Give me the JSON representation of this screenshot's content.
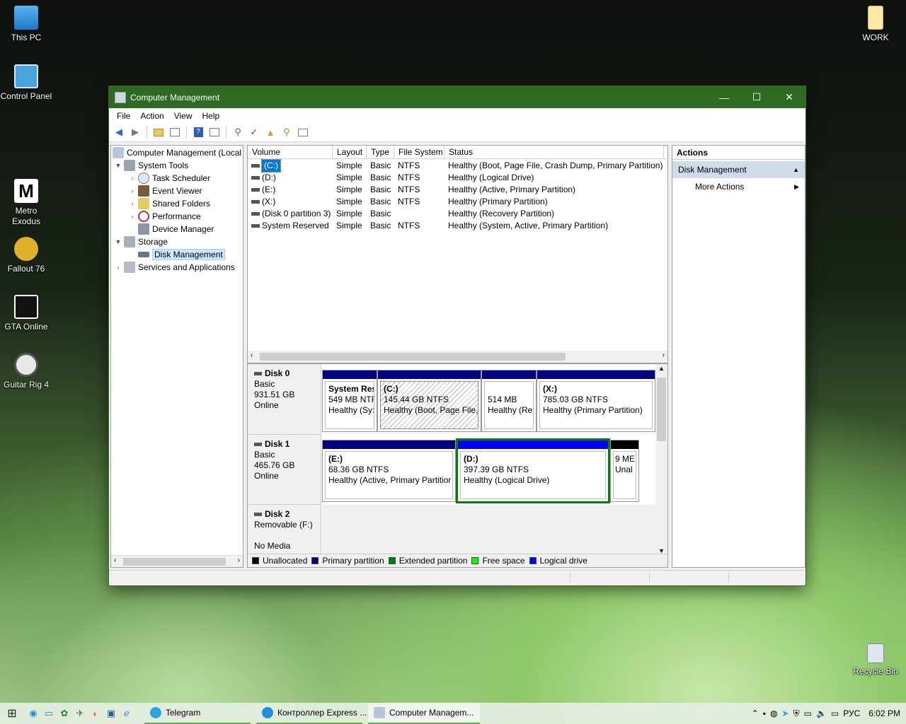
{
  "desktop": {
    "icons_left": [
      "This PC",
      "Control Panel",
      "Metro Exodus",
      "Fallout 76",
      "GTA Online",
      "Guitar Rig 4"
    ],
    "work": "WORK",
    "recycle": "Recycle Bin"
  },
  "window": {
    "title": "Computer Management",
    "controls": {
      "minimize": "—",
      "maximize": "☐",
      "close": "✕"
    },
    "menu": [
      "File",
      "Action",
      "View",
      "Help"
    ]
  },
  "tree": {
    "root": "Computer Management (Local",
    "system_tools": "System Tools",
    "task_scheduler": "Task Scheduler",
    "event_viewer": "Event Viewer",
    "shared_folders": "Shared Folders",
    "performance": "Performance",
    "device_manager": "Device Manager",
    "storage": "Storage",
    "disk_management": "Disk Management",
    "services": "Services and Applications"
  },
  "volumes": {
    "headers": [
      "Volume",
      "Layout",
      "Type",
      "File System",
      "Status"
    ],
    "rows": [
      [
        "(C:)",
        "Simple",
        "Basic",
        "NTFS",
        "Healthy (Boot, Page File, Crash Dump, Primary Partition)"
      ],
      [
        "(D:)",
        "Simple",
        "Basic",
        "NTFS",
        "Healthy (Logical Drive)"
      ],
      [
        "(E:)",
        "Simple",
        "Basic",
        "NTFS",
        "Healthy (Active, Primary Partition)"
      ],
      [
        "(X:)",
        "Simple",
        "Basic",
        "NTFS",
        "Healthy (Primary Partition)"
      ],
      [
        "(Disk 0 partition 3)",
        "Simple",
        "Basic",
        "",
        "Healthy (Recovery Partition)"
      ],
      [
        "System Reserved",
        "Simple",
        "Basic",
        "NTFS",
        "Healthy (System, Active, Primary Partition)"
      ]
    ]
  },
  "disks": {
    "disk0": {
      "name": "Disk 0",
      "type": "Basic",
      "size": "931.51 GB",
      "state": "Online",
      "parts": [
        {
          "name": "System Res",
          "size": "549 MB NTF",
          "status": "Healthy (Sy:"
        },
        {
          "name": "(C:)",
          "size": "145.44 GB NTFS",
          "status": "Healthy (Boot, Page File,"
        },
        {
          "name": "",
          "size": "514 MB",
          "status": "Healthy (Re"
        },
        {
          "name": "(X:)",
          "size": "785.03 GB NTFS",
          "status": "Healthy (Primary Partition)"
        }
      ]
    },
    "disk1": {
      "name": "Disk 1",
      "type": "Basic",
      "size": "465.76 GB",
      "state": "Online",
      "parts": [
        {
          "name": "(E:)",
          "size": "68.36 GB NTFS",
          "status": "Healthy (Active, Primary Partitior"
        },
        {
          "name": "(D:)",
          "size": "397.39 GB NTFS",
          "status": "Healthy (Logical Drive)"
        },
        {
          "name": "",
          "size": "9 ME",
          "status": "Unal"
        }
      ]
    },
    "disk2": {
      "name": "Disk 2",
      "type": "Removable (F:)",
      "state": "No Media"
    }
  },
  "legend": [
    "Unallocated",
    "Primary partition",
    "Extended partition",
    "Free space",
    "Logical drive"
  ],
  "colors": {
    "unallocated": "#000000",
    "primary": "#000080",
    "extended": "#008000",
    "free": "#00ff00",
    "logical": "#0000ff",
    "title_bar": "#2f6a22"
  },
  "actions": {
    "header": "Actions",
    "section": "Disk Management",
    "more": "More Actions"
  },
  "taskbar": {
    "apps": [
      "Telegram",
      "Контроллер Express ...",
      "Computer Managem..."
    ],
    "lang": "РУС",
    "time": "6:02 PM"
  }
}
